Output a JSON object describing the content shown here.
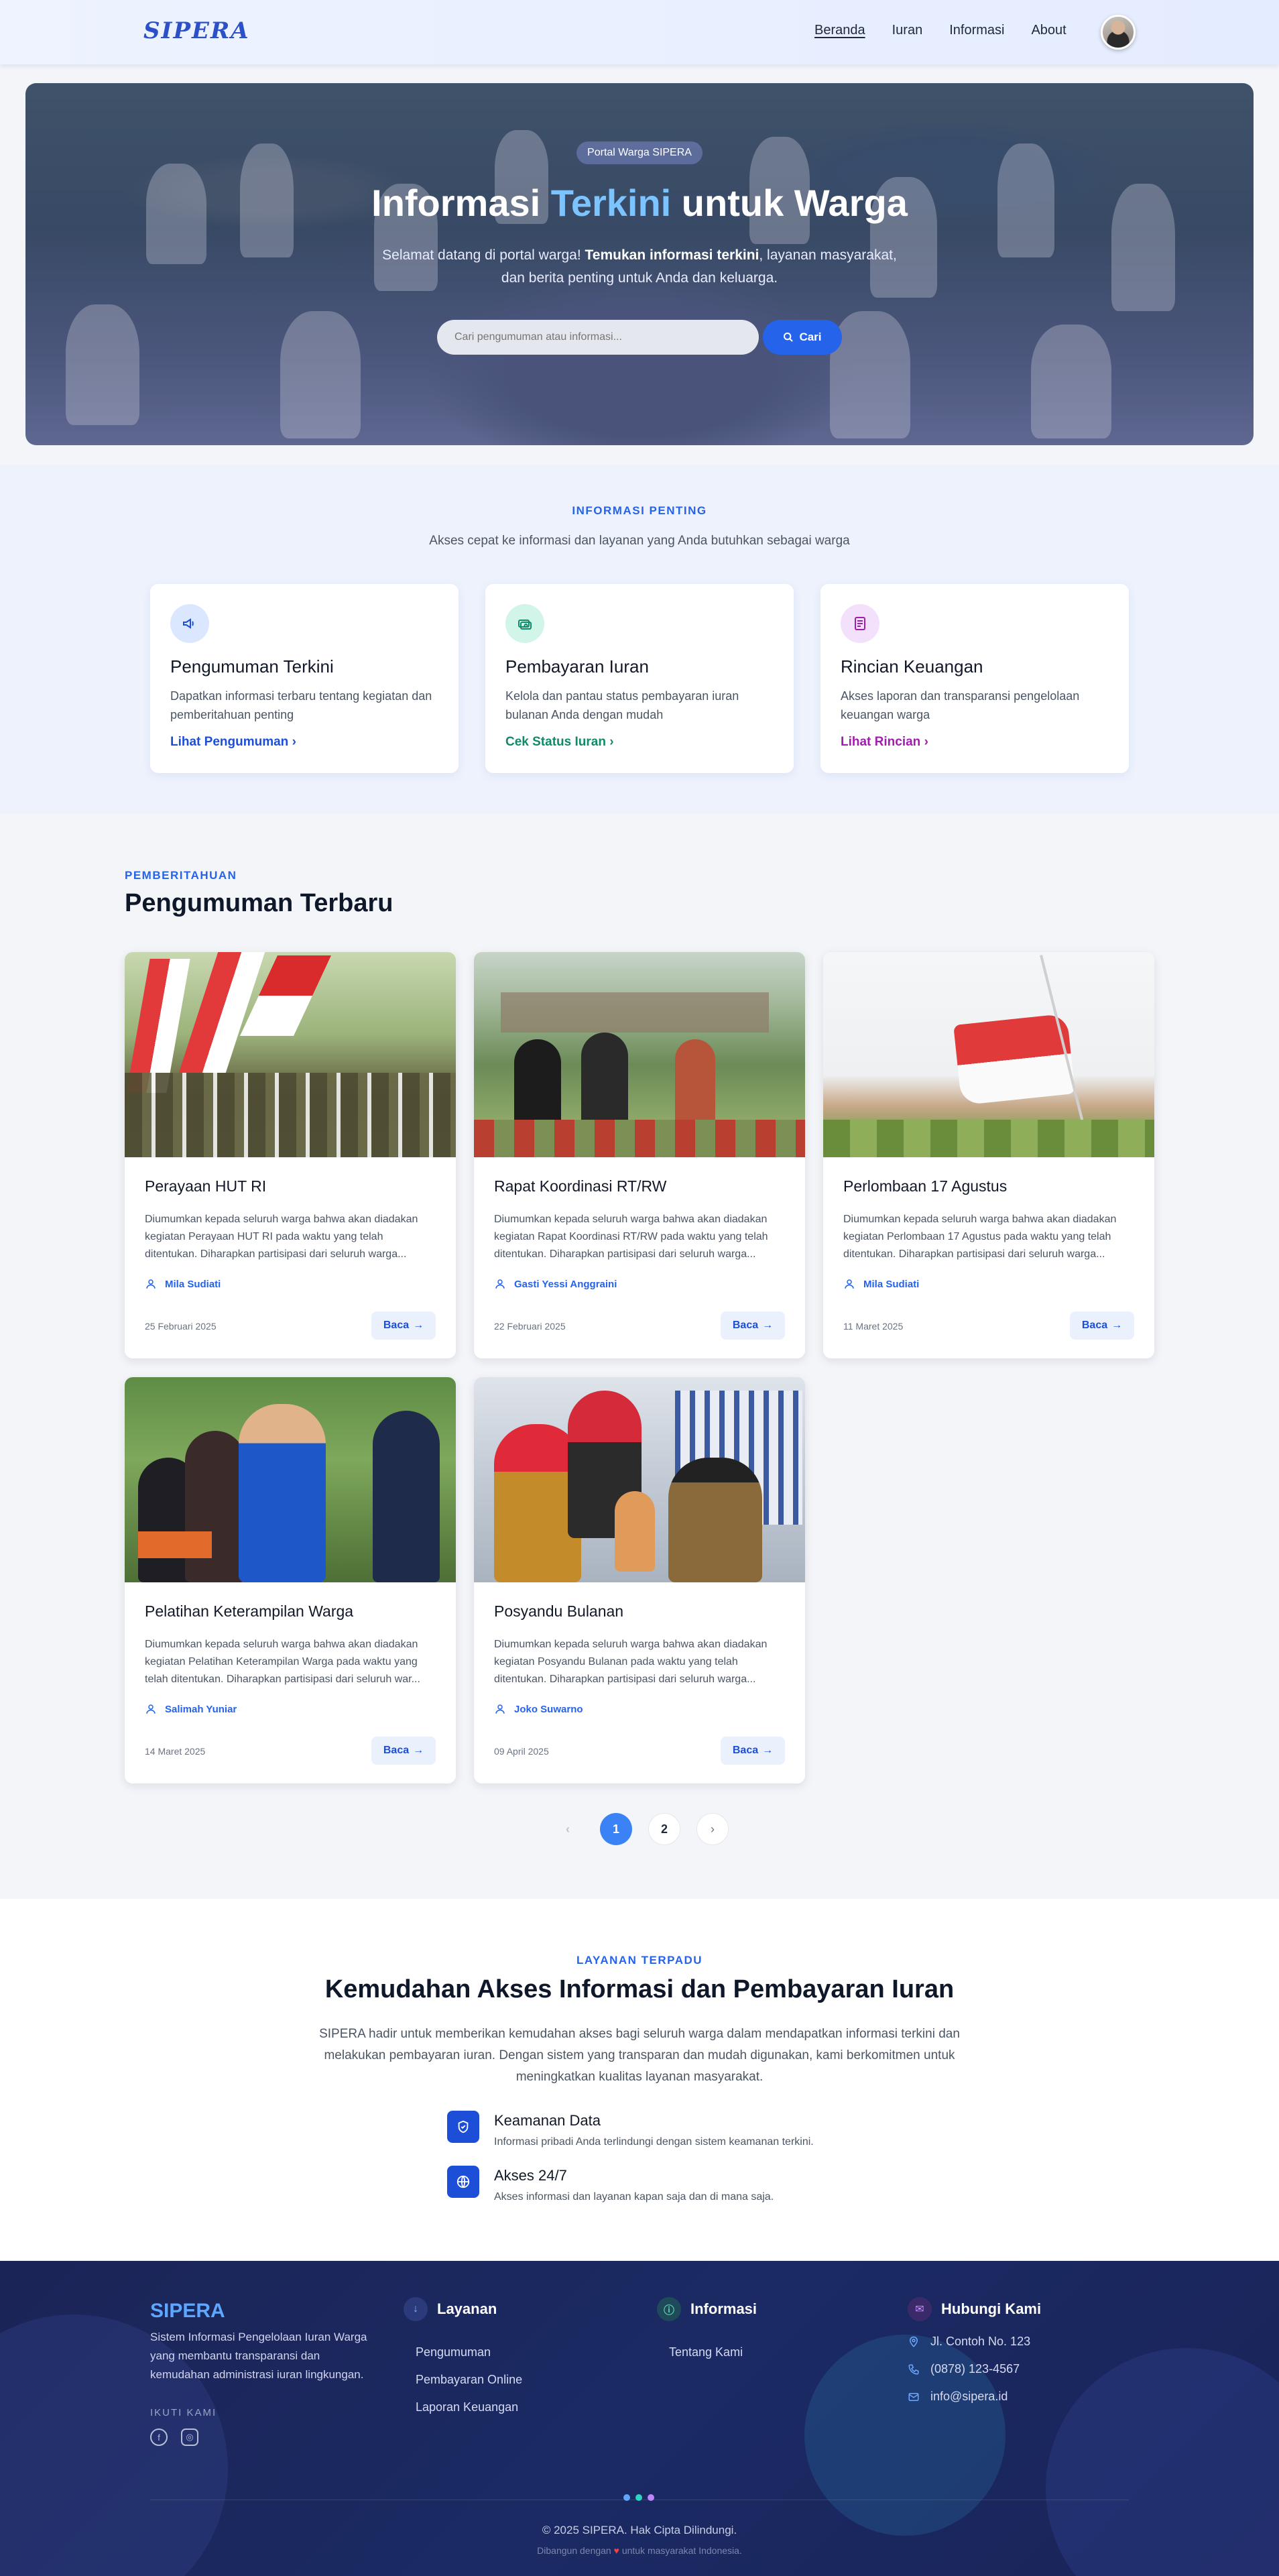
{
  "nav": {
    "brand": "SIPERA",
    "links": [
      "Beranda",
      "Iuran",
      "Informasi",
      "About"
    ]
  },
  "hero": {
    "badge": "Portal Warga SIPERA",
    "title_pre": "Informasi ",
    "title_hl": "Terkini",
    "title_post": " untuk Warga",
    "sub_pre": "Selamat datang di portal warga! ",
    "sub_bold": "Temukan informasi terkini",
    "sub_post": ", layanan masyarakat, dan berita penting untuk Anda dan keluarga.",
    "search_placeholder": "Cari pengumuman atau informasi...",
    "search_button": "Cari"
  },
  "info": {
    "eyebrow": "INFORMASI PENTING",
    "desc": "Akses cepat ke informasi dan layanan yang Anda butuhkan sebagai warga",
    "cards": [
      {
        "title": "Pengumuman Terkini",
        "desc": "Dapatkan informasi terbaru tentang kegiatan dan pemberitahuan penting",
        "link": "Lihat Pengumuman",
        "color": "#1d4ed8",
        "bg": "#dbe7ff",
        "icon": "megaphone-icon"
      },
      {
        "title": "Pembayaran Iuran",
        "desc": "Kelola dan pantau status pembayaran iuran bulanan Anda dengan mudah",
        "link": "Cek Status Iuran",
        "color": "#0f8a6a",
        "bg": "#d1f5e8",
        "icon": "money-icon"
      },
      {
        "title": "Rincian Keuangan",
        "desc": "Akses laporan dan transparansi pengelolaan keuangan warga",
        "link": "Lihat Rincian",
        "color": "#a21caf",
        "bg": "#f3e1fb",
        "icon": "document-icon"
      }
    ]
  },
  "announcements": {
    "eyebrow": "PEMBERITAHUAN",
    "title": "Pengumuman Terbaru",
    "read_label": "Baca",
    "items": [
      {
        "title": "Perayaan HUT RI",
        "desc": "Diumumkan kepada seluruh warga bahwa akan diadakan kegiatan Perayaan HUT RI pada waktu yang telah ditentukan. Diharapkan partisipasi dari seluruh warga...",
        "author": "Mila Sudiati",
        "date": "25 Februari 2025"
      },
      {
        "title": "Rapat Koordinasi RT/RW",
        "desc": "Diumumkan kepada seluruh warga bahwa akan diadakan kegiatan Rapat Koordinasi RT/RW pada waktu yang telah ditentukan. Diharapkan partisipasi dari seluruh warga...",
        "author": "Gasti Yessi Anggraini",
        "date": "22 Februari 2025"
      },
      {
        "title": "Perlombaan 17 Agustus",
        "desc": "Diumumkan kepada seluruh warga bahwa akan diadakan kegiatan Perlombaan 17 Agustus pada waktu yang telah ditentukan. Diharapkan partisipasi dari seluruh warga...",
        "author": "Mila Sudiati",
        "date": "11 Maret 2025"
      },
      {
        "title": "Pelatihan Keterampilan Warga",
        "desc": "Diumumkan kepada seluruh warga bahwa akan diadakan kegiatan Pelatihan Keterampilan Warga pada waktu yang telah ditentukan. Diharapkan partisipasi dari seluruh war...",
        "author": "Salimah Yuniar",
        "date": "14 Maret 2025"
      },
      {
        "title": "Posyandu Bulanan",
        "desc": "Diumumkan kepada seluruh warga bahwa akan diadakan kegiatan Posyandu Bulanan pada waktu yang telah ditentukan. Diharapkan partisipasi dari seluruh warga...",
        "author": "Joko Suwarno",
        "date": "09 April 2025"
      }
    ]
  },
  "pagination": {
    "pages": [
      "1",
      "2"
    ],
    "current": 1
  },
  "services": {
    "eyebrow": "LAYANAN TERPADU",
    "title": "Kemudahan Akses Informasi dan Pembayaran Iuran",
    "desc": "SIPERA hadir untuk memberikan kemudahan akses bagi seluruh warga dalam mendapatkan informasi terkini dan melakukan pembayaran iuran. Dengan sistem yang transparan dan mudah digunakan, kami berkomitmen untuk meningkatkan kualitas layanan masyarakat.",
    "features": [
      {
        "title": "Keamanan Data",
        "desc": "Informasi pribadi Anda terlindungi dengan sistem keamanan terkini."
      },
      {
        "title": "Akses 24/7",
        "desc": "Akses informasi dan layanan kapan saja dan di mana saja."
      }
    ]
  },
  "footer": {
    "brand": "SIPERA",
    "about": "Sistem Informasi Pengelolaan Iuran Warga yang membantu transparansi dan kemudahan administrasi iuran lingkungan.",
    "follow": "IKUTI KAMI",
    "layanan": {
      "title": "Layanan",
      "items": [
        "Pengumuman",
        "Pembayaran Online",
        "Laporan Keuangan"
      ]
    },
    "informasi": {
      "title": "Informasi",
      "items": [
        "Tentang Kami"
      ]
    },
    "kontak": {
      "title": "Hubungi Kami",
      "address": "Jl. Contoh No. 123",
      "phone": "(0878) 123-4567",
      "email": "info@sipera.id"
    },
    "copyright": "© 2025 SIPERA. Hak Cipta Dilindungi.",
    "built_pre": "Dibangun dengan",
    "built_post": "untuk masyarakat Indonesia."
  }
}
